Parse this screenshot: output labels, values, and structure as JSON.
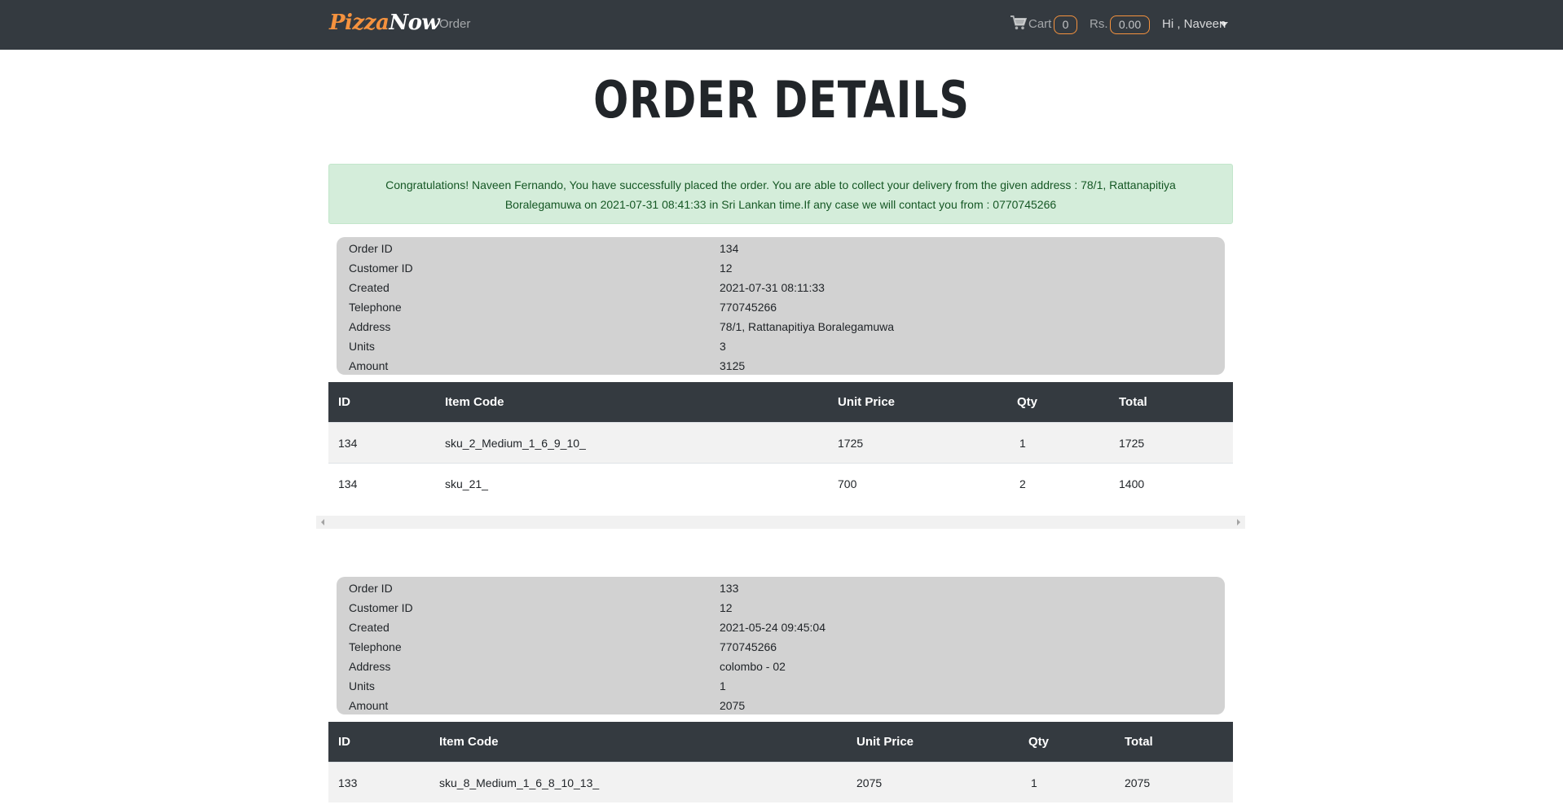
{
  "navbar": {
    "brand_part1": "Pizza",
    "brand_part2": "Now",
    "order_link": "Order",
    "cart_label": "Cart",
    "cart_count": "0",
    "currency_label": "Rs.",
    "cart_amount": "0.00",
    "user_greeting": "Hi , Naveen",
    "colors": {
      "background": "#343a40",
      "accent": "#f5923e"
    },
    "icons": [
      "shopping-cart-icon",
      "caret-down-icon"
    ]
  },
  "page_title": "ORDER DETAILS",
  "alert": {
    "message": "Congratulations! Naveen Fernando, You have successfully placed the order. You are able to collect your delivery from the given address : 78/1, Rattanapitiya Boralegamuwa on 2021-07-31 08:41:33 in Sri Lankan time.If any case we will contact you from : 0770745266",
    "colors": {
      "background": "#d4edda",
      "text": "#155724"
    }
  },
  "orders": [
    {
      "info": [
        {
          "label": "Order ID",
          "value": "134"
        },
        {
          "label": "Customer ID",
          "value": "12"
        },
        {
          "label": "Created",
          "value": "2021-07-31 08:11:33"
        },
        {
          "label": "Telephone",
          "value": "770745266"
        },
        {
          "label": "Address",
          "value": "78/1, Rattanapitiya Boralegamuwa"
        },
        {
          "label": "Units",
          "value": "3"
        },
        {
          "label": "Amount",
          "value": "3125"
        }
      ],
      "columns": [
        "ID",
        "Item Code",
        "Unit Price",
        "Qty",
        "Total"
      ],
      "rows": [
        [
          "134",
          "sku_2_Medium_1_6_9_10_",
          "1725",
          "1",
          "1725"
        ],
        [
          "134",
          "sku_21_",
          "700",
          "2",
          "1400"
        ]
      ]
    },
    {
      "info": [
        {
          "label": "Order ID",
          "value": "133"
        },
        {
          "label": "Customer ID",
          "value": "12"
        },
        {
          "label": "Created",
          "value": "2021-05-24 09:45:04"
        },
        {
          "label": "Telephone",
          "value": "770745266"
        },
        {
          "label": "Address",
          "value": "colombo - 02"
        },
        {
          "label": "Units",
          "value": "1"
        },
        {
          "label": "Amount",
          "value": "2075"
        }
      ],
      "columns": [
        "ID",
        "Item Code",
        "Unit Price",
        "Qty",
        "Total"
      ],
      "rows": [
        [
          "133",
          "sku_8_Medium_1_6_8_10_13_",
          "2075",
          "1",
          "2075"
        ]
      ]
    }
  ]
}
